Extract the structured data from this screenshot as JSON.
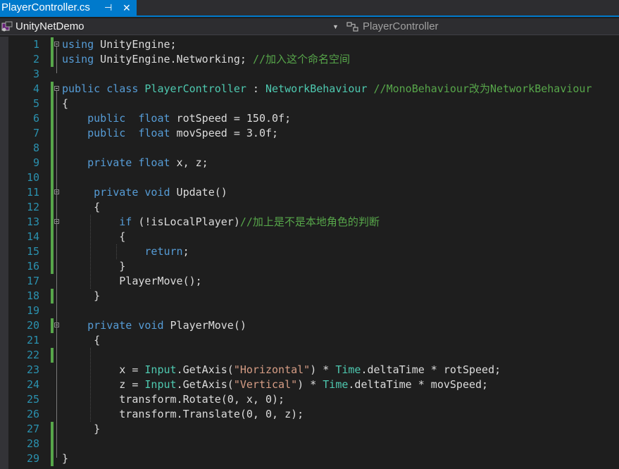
{
  "tab": {
    "title": "PlayerController.cs",
    "pin": "⊣",
    "close": "✕"
  },
  "navbar": {
    "project": "UnityNetDemo",
    "class": "PlayerController",
    "dropdown_arrow": "▼"
  },
  "icons": {
    "project": "csharp-project-icon",
    "class": "class-icon",
    "pin": "pin-icon",
    "close": "close-icon"
  },
  "colors": {
    "keyword": "#569cd6",
    "type": "#4ec9b0",
    "string": "#d69d85",
    "comment": "#57a64a",
    "line_number": "#2b91af",
    "accent": "#007acc"
  },
  "lines": [
    [
      {
        "t": "using",
        "c": "kw"
      },
      {
        "t": " UnityEngine;"
      }
    ],
    [
      {
        "t": "using",
        "c": "kw"
      },
      {
        "t": " UnityEngine.Networking; "
      },
      {
        "t": "//加入这个命名空间",
        "c": "cm"
      }
    ],
    [],
    [
      {
        "t": "public",
        "c": "kw"
      },
      {
        "t": " "
      },
      {
        "t": "class",
        "c": "kw"
      },
      {
        "t": " "
      },
      {
        "t": "PlayerController",
        "c": "ty"
      },
      {
        "t": " : "
      },
      {
        "t": "NetworkBehaviour",
        "c": "ty"
      },
      {
        "t": " "
      },
      {
        "t": "//MonoBehaviour改为NetworkBehaviour",
        "c": "cm"
      }
    ],
    [
      {
        "t": "{"
      }
    ],
    [
      {
        "t": "    "
      },
      {
        "t": "public",
        "c": "kw"
      },
      {
        "t": "  "
      },
      {
        "t": "float",
        "c": "kw"
      },
      {
        "t": " rotSpeed = 150.0f;"
      }
    ],
    [
      {
        "t": "    "
      },
      {
        "t": "public",
        "c": "kw"
      },
      {
        "t": "  "
      },
      {
        "t": "float",
        "c": "kw"
      },
      {
        "t": " movSpeed = 3.0f;"
      }
    ],
    [],
    [
      {
        "t": "    "
      },
      {
        "t": "private",
        "c": "kw"
      },
      {
        "t": " "
      },
      {
        "t": "float",
        "c": "kw"
      },
      {
        "t": " x, z;"
      }
    ],
    [],
    [
      {
        "t": "     "
      },
      {
        "t": "private",
        "c": "kw"
      },
      {
        "t": " "
      },
      {
        "t": "void",
        "c": "kw"
      },
      {
        "t": " Update()"
      }
    ],
    [
      {
        "t": "     {"
      }
    ],
    [
      {
        "t": "         "
      },
      {
        "t": "if",
        "c": "kw"
      },
      {
        "t": " (!isLocalPlayer)"
      },
      {
        "t": "//加上是不是本地角色的判断",
        "c": "cm"
      }
    ],
    [
      {
        "t": "         {"
      }
    ],
    [
      {
        "t": "             "
      },
      {
        "t": "return",
        "c": "kw"
      },
      {
        "t": ";"
      }
    ],
    [
      {
        "t": "         }"
      }
    ],
    [
      {
        "t": "         PlayerMove();"
      }
    ],
    [
      {
        "t": "     }"
      }
    ],
    [],
    [
      {
        "t": "    "
      },
      {
        "t": "private",
        "c": "kw"
      },
      {
        "t": " "
      },
      {
        "t": "void",
        "c": "kw"
      },
      {
        "t": " PlayerMove()"
      }
    ],
    [
      {
        "t": "     {"
      }
    ],
    [],
    [
      {
        "t": "         x = "
      },
      {
        "t": "Input",
        "c": "ty"
      },
      {
        "t": ".GetAxis("
      },
      {
        "t": "\"Horizontal\"",
        "c": "str"
      },
      {
        "t": ") * "
      },
      {
        "t": "Time",
        "c": "ty"
      },
      {
        "t": ".deltaTime * rotSpeed;"
      }
    ],
    [
      {
        "t": "         z = "
      },
      {
        "t": "Input",
        "c": "ty"
      },
      {
        "t": ".GetAxis("
      },
      {
        "t": "\"Vertical\"",
        "c": "str"
      },
      {
        "t": ") * "
      },
      {
        "t": "Time",
        "c": "ty"
      },
      {
        "t": ".deltaTime * movSpeed;"
      }
    ],
    [
      {
        "t": "         transform.Rotate(0, x, 0);"
      }
    ],
    [
      {
        "t": "         transform.Translate(0, 0, z);"
      }
    ],
    [
      {
        "t": "     }"
      }
    ],
    [],
    [
      {
        "t": "}"
      }
    ]
  ],
  "line_numbers": [
    "1",
    "2",
    "3",
    "4",
    "5",
    "6",
    "7",
    "8",
    "9",
    "10",
    "11",
    "12",
    "13",
    "14",
    "15",
    "16",
    "17",
    "18",
    "19",
    "20",
    "21",
    "22",
    "23",
    "24",
    "25",
    "26",
    "27",
    "28",
    "29"
  ]
}
